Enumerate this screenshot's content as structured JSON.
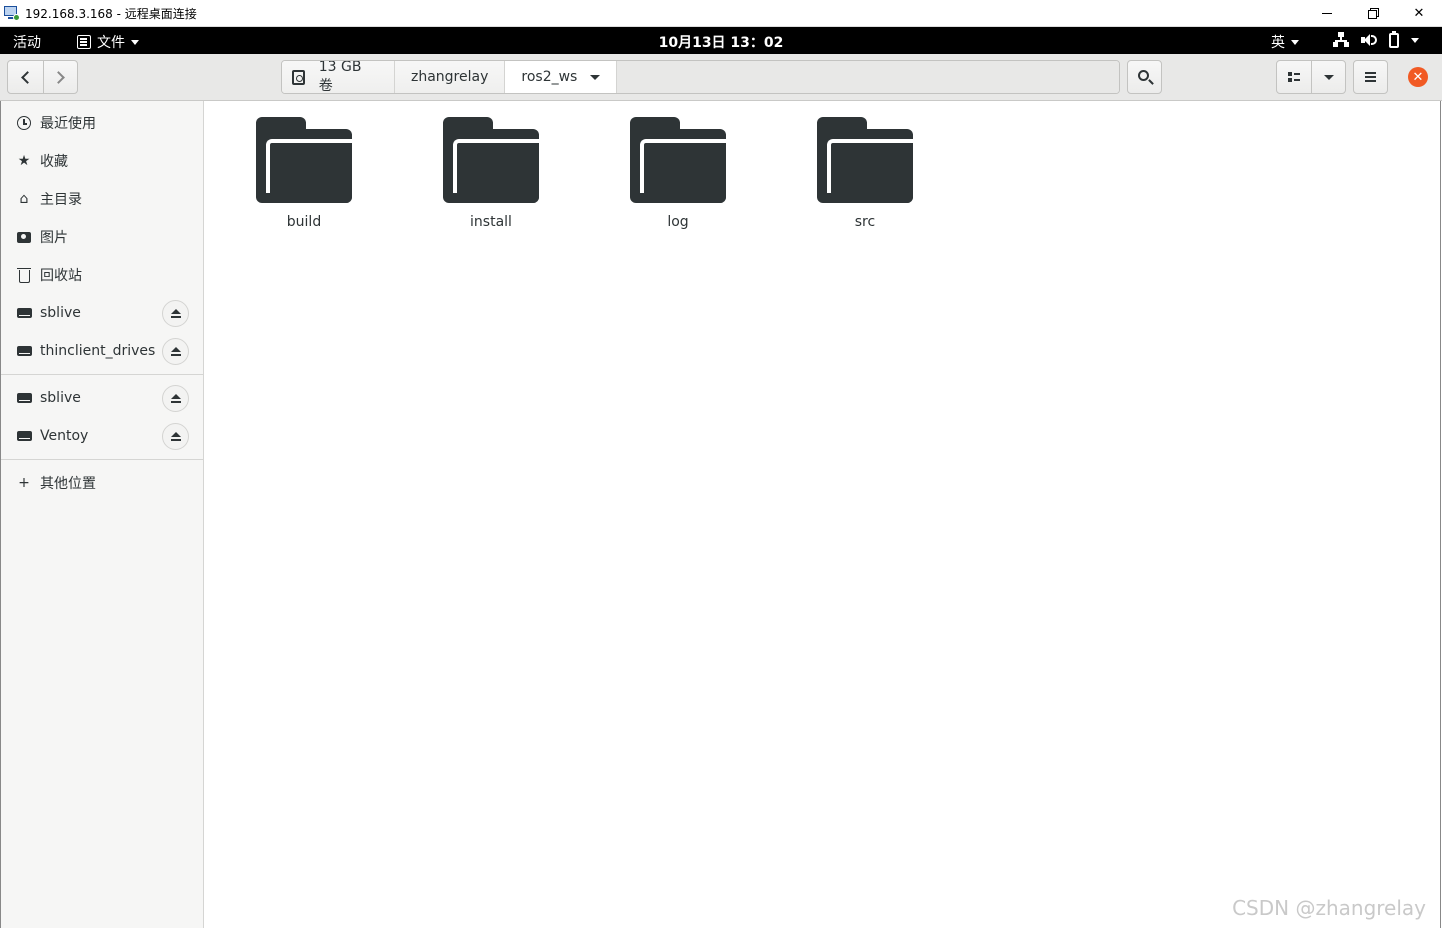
{
  "rdp": {
    "title": "192.168.3.168 - 远程桌面连接"
  },
  "topbar": {
    "activities": "活动",
    "app_menu": "文件",
    "clock": "10月13日  13：02",
    "input_method": "英"
  },
  "header": {
    "path": [
      "13 GB 卷",
      "zhangrelay",
      "ros2_ws"
    ]
  },
  "sidebar": {
    "places": [
      {
        "label": "最近使用",
        "icon": "clock-icon"
      },
      {
        "label": "收藏",
        "icon": "star-icon"
      },
      {
        "label": "主目录",
        "icon": "home-icon"
      },
      {
        "label": "图片",
        "icon": "camera-icon"
      },
      {
        "label": "回收站",
        "icon": "trash-icon"
      }
    ],
    "drives": [
      {
        "label": "sblive"
      },
      {
        "label": "thinclient_drives"
      },
      {
        "label": "sblive"
      },
      {
        "label": "Ventoy"
      }
    ],
    "other": "其他位置"
  },
  "files": [
    {
      "name": "build"
    },
    {
      "name": "install"
    },
    {
      "name": "log"
    },
    {
      "name": "src"
    }
  ],
  "watermark": "CSDN @zhangrelay",
  "colors": {
    "accent_close": "#f15a24",
    "icon_dark": "#2e3436",
    "sidebar_bg": "#f6f6f5",
    "header_bg": "#e8e8e7"
  }
}
